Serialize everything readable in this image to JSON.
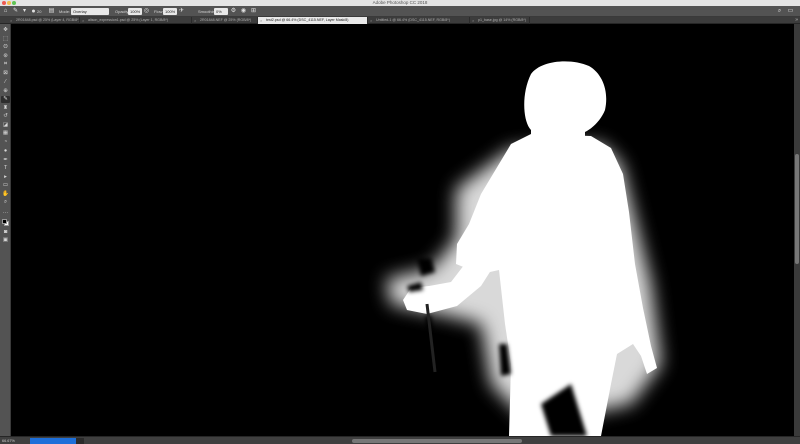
{
  "window": {
    "title": "Adobe Photoshop CC 2018",
    "traffic_lights": [
      "#ee5b52",
      "#f4bd4f",
      "#5fc454"
    ]
  },
  "options": {
    "mode_label": "Mode:",
    "mode_value": "Overlay",
    "opacity_label": "Opacity:",
    "opacity_value": "100%",
    "flow_label": "Flow:",
    "flow_value": "100%",
    "smoothing_label": "Smoothing:",
    "smoothing_value": "0%",
    "brush_size": "20"
  },
  "tabs": [
    {
      "label": "2R01848.psd @ 25% (Layer 4, RGB/8*)"
    },
    {
      "label": "alison_expression1.psd @ 25% (Layer 1, RGB/8*)"
    },
    {
      "label": "2R01848.NEF @ 25% (RGB/8*)"
    },
    {
      "label": "test2.psd @ 66.4% (DSC_4115.NEF, Layer Mask/8)",
      "active": true
    },
    {
      "label": "Untitled-1 @ 66.4% (DSC_4115.NEF, RGB/8*)"
    },
    {
      "label": "p1_base.jpg @ 14% (RGB/8*)"
    }
  ],
  "tools": [
    {
      "name": "move-tool",
      "glyph": "✥"
    },
    {
      "name": "marquee-tool",
      "glyph": "⬚"
    },
    {
      "name": "lasso-tool",
      "glyph": "ʘ"
    },
    {
      "name": "quick-select-tool",
      "glyph": "⊛"
    },
    {
      "name": "crop-tool",
      "glyph": "⌗"
    },
    {
      "name": "frame-tool",
      "glyph": "⊠"
    },
    {
      "name": "eyedropper-tool",
      "glyph": "⁄"
    },
    {
      "name": "healing-tool",
      "glyph": "⊕"
    },
    {
      "name": "brush-tool",
      "glyph": "✎",
      "active": true
    },
    {
      "name": "stamp-tool",
      "glyph": "♜"
    },
    {
      "name": "history-brush-tool",
      "glyph": "↺"
    },
    {
      "name": "eraser-tool",
      "glyph": "◪"
    },
    {
      "name": "gradient-tool",
      "glyph": "▦"
    },
    {
      "name": "blur-tool",
      "glyph": "◔"
    },
    {
      "name": "dodge-tool",
      "glyph": "●"
    },
    {
      "name": "pen-tool",
      "glyph": "✒"
    },
    {
      "name": "type-tool",
      "glyph": "T"
    },
    {
      "name": "path-select-tool",
      "glyph": "▸"
    },
    {
      "name": "shape-tool",
      "glyph": "▭"
    },
    {
      "name": "hand-tool",
      "glyph": "✋"
    },
    {
      "name": "zoom-tool",
      "glyph": "⌕"
    },
    {
      "name": "more-tools",
      "glyph": "…"
    }
  ],
  "colors": {
    "foreground": "#000000",
    "background": "#ffffff",
    "ui_panel": "#535353",
    "active_tab": "#e9e9e9",
    "progress_fill": "#1e6fd9"
  },
  "status": {
    "zoom": "66.67%",
    "progress_percent": 85
  }
}
